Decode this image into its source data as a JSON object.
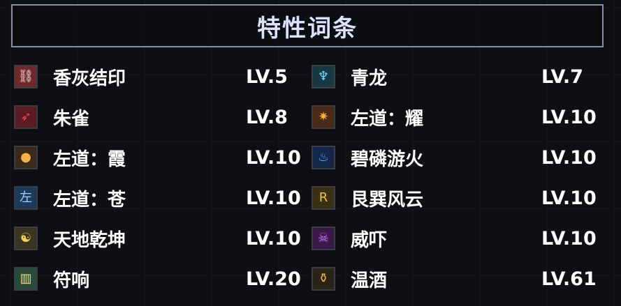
{
  "title": "特性词条",
  "traits_left": [
    {
      "name": "香灰结印",
      "level": "LV.5",
      "icon": "incense-ash-seal-icon",
      "icon_glyph": "⛓",
      "icon_bg": "#6e2a2a",
      "icon_fg": "#f0e0e0"
    },
    {
      "name": "朱雀",
      "level": "LV.8",
      "icon": "vermilion-bird-icon",
      "icon_glyph": "➶",
      "icon_bg": "#5a1c22",
      "icon_fg": "#ff4050"
    },
    {
      "name": "左道：霞",
      "level": "LV.10",
      "icon": "flame-orb-icon",
      "icon_glyph": "●",
      "icon_bg": "#3a2a1a",
      "icon_fg": "#f6b24a"
    },
    {
      "name": "左道：苍",
      "level": "LV.10",
      "icon": "cang-rune-icon",
      "icon_glyph": "左",
      "icon_bg": "#1e3a5a",
      "icon_fg": "#9ecfff"
    },
    {
      "name": "天地乾坤",
      "level": "LV.10",
      "icon": "heaven-earth-icon",
      "icon_glyph": "☯",
      "icon_bg": "#3a3520",
      "icon_fg": "#f2d25a"
    },
    {
      "name": "符响",
      "level": "LV.20",
      "icon": "talisman-chime-icon",
      "icon_glyph": "▥",
      "icon_bg": "#2a4a3a",
      "icon_fg": "#f0e080"
    }
  ],
  "traits_right": [
    {
      "name": "青龙",
      "level": "LV.7",
      "icon": "azure-dragon-icon",
      "icon_glyph": "♆",
      "icon_bg": "#183844",
      "icon_fg": "#6fe0ff"
    },
    {
      "name": "左道：耀",
      "level": "LV.10",
      "icon": "radiant-burst-icon",
      "icon_glyph": "✷",
      "icon_bg": "#4a2a14",
      "icon_fg": "#ffb03a"
    },
    {
      "name": "碧磷游火",
      "level": "LV.10",
      "icon": "blue-will-o-wisp-icon",
      "icon_glyph": "♨",
      "icon_bg": "#14264a",
      "icon_fg": "#5aa8ff"
    },
    {
      "name": "艮巽风云",
      "level": "LV.10",
      "icon": "gen-xun-rune-icon",
      "icon_glyph": "R",
      "icon_bg": "#3a3014",
      "icon_fg": "#f2c24a"
    },
    {
      "name": "威吓",
      "level": "LV.10",
      "icon": "skull-intimidate-icon",
      "icon_glyph": "☠",
      "icon_bg": "#3a1a4a",
      "icon_fg": "#d27aff"
    },
    {
      "name": "温酒",
      "level": "LV.61",
      "icon": "warm-wine-icon",
      "icon_glyph": "⚱",
      "icon_bg": "#2a2418",
      "icon_fg": "#e8b44a"
    }
  ]
}
